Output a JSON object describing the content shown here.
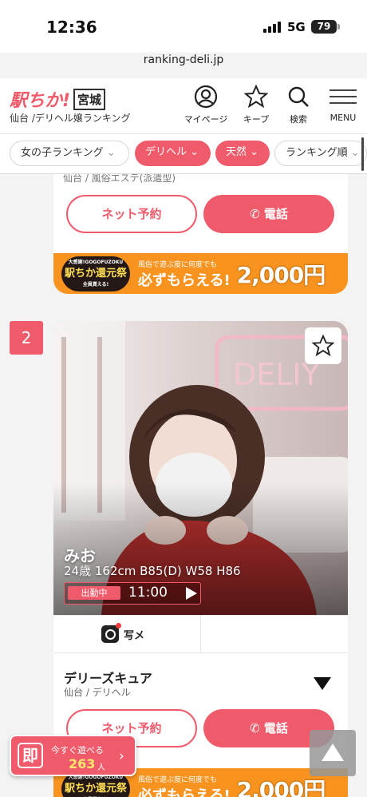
{
  "status_bar": {
    "time": "12:36",
    "network": "5G",
    "battery": "79"
  },
  "browser": {
    "url": "ranking-deli.jp"
  },
  "header": {
    "logo": "駅ちか!",
    "prefecture": "宮城",
    "subtitle": "仙台 /デリヘル嬢ランキング",
    "nav": [
      {
        "label": "マイページ",
        "icon": "user-icon"
      },
      {
        "label": "キープ",
        "icon": "star-icon"
      },
      {
        "label": "検索",
        "icon": "search-icon"
      },
      {
        "label": "MENU",
        "icon": "menu-icon"
      }
    ]
  },
  "filters": [
    {
      "label": "女の子ランキング",
      "style": "white"
    },
    {
      "label": "デリヘル",
      "style": "red"
    },
    {
      "label": "天然",
      "style": "red"
    },
    {
      "label": "ランキング順",
      "style": "white"
    }
  ],
  "card1": {
    "shop_area_partial": "仙台 / 風俗エステ(派遣型)",
    "reserve_label": "ネット予約",
    "call_label": "電話"
  },
  "banner": {
    "seal_small": "大感謝!GOGOFUZOKU",
    "seal_main": "駅ちか還元祭",
    "seal_bottom": "全員貰える!",
    "line1": "風俗で遊ぶ度に何度でも",
    "line2": "必ずもらえる!",
    "amount": "2,000円"
  },
  "card2": {
    "rank": "2",
    "name": "みお",
    "specs": "24歳 162cm B85(D) W58 H86",
    "work_status": "出勤中",
    "work_time": "11:00",
    "photo_tab_label": "写メ",
    "shop_name": "デリーズキュア",
    "shop_area": "仙台 / デリヘル",
    "reserve_label": "ネット予約",
    "call_label": "電話"
  },
  "floating": {
    "badge": "即",
    "text": "今すぐ遊べる",
    "count": "263",
    "unit": "人"
  },
  "colors": {
    "accent": "#ef5b6a",
    "banner": "#f7931e"
  }
}
